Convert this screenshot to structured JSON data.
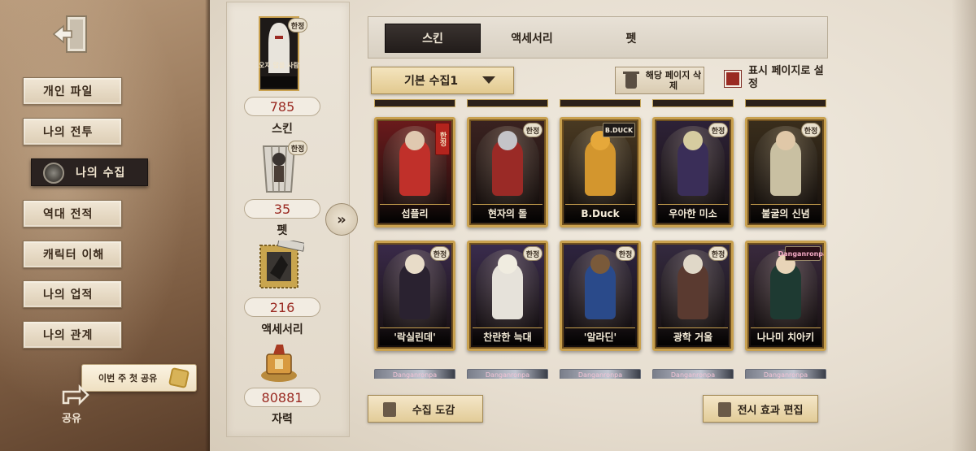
{
  "sidebar": {
    "items": [
      {
        "label": "개인 파일"
      },
      {
        "label": "나의 전투"
      },
      {
        "label": "나의 수집"
      },
      {
        "label": "역대 전적"
      },
      {
        "label": "캐릭터 이해"
      },
      {
        "label": "나의 업적"
      },
      {
        "label": "나의 관계"
      }
    ],
    "active_index": 2,
    "share_bubble": "이번 주 첫 공유",
    "share_label": "공유"
  },
  "stats": {
    "portrait_caption": "오지 않을 사람",
    "portrait_badge": "한정",
    "skin_count": "785",
    "skin_label": "스킨",
    "pet_badge": "한정",
    "pet_count": "35",
    "pet_label": "펫",
    "accessory_count": "216",
    "accessory_label": "액세서리",
    "material_count": "80881",
    "material_label": "자력"
  },
  "tabs": [
    {
      "label": "스킨"
    },
    {
      "label": "액세서리"
    },
    {
      "label": "펫"
    }
  ],
  "toolbar": {
    "collection_select": "기본 수집1",
    "delete_page": "해당 페이지 삭제",
    "set_display": "표시 페이지로 설정"
  },
  "cards_row1": [
    {
      "name": "섭플리",
      "badge": "한정",
      "badge_style": "red",
      "color": "#6b1a1c",
      "fig": "#c0302a",
      "head": "#e0c9b0"
    },
    {
      "name": "현자의 돌",
      "badge": "한정",
      "badge_style": "",
      "color": "#3a2220",
      "fig": "#9a2a26",
      "head": "#c4c4c8"
    },
    {
      "name": "B.Duck",
      "badge": "B.DUCK",
      "badge_style": "bduck",
      "color": "#4a3a22",
      "fig": "#d3962e",
      "head": "#e6a83a"
    },
    {
      "name": "우아한 미소",
      "badge": "한정",
      "badge_style": "",
      "color": "#2e2238",
      "fig": "#3a2e58",
      "head": "#d6cca0"
    },
    {
      "name": "불굴의 신념",
      "badge": "한정",
      "badge_style": "",
      "color": "#3a2e1c",
      "fig": "#c9c0a2",
      "head": "#e0c8a8"
    }
  ],
  "cards_row2": [
    {
      "name": "'락실린데'",
      "badge": "한정",
      "badge_style": "",
      "color": "#3a2a4a",
      "fig": "#2a2230",
      "head": "#e8dcc8"
    },
    {
      "name": "찬란한 늑대",
      "badge": "한정",
      "badge_style": "",
      "color": "#3a2c4e",
      "fig": "#e6e2da",
      "head": "#f0ece0"
    },
    {
      "name": "'알라딘'",
      "badge": "한정",
      "badge_style": "",
      "color": "#2e2440",
      "fig": "#2a4a8a",
      "head": "#7a5a3a"
    },
    {
      "name": "광학 거울",
      "badge": "한정",
      "badge_style": "",
      "color": "#342a40",
      "fig": "#5a3a30",
      "head": "#e0d8c8"
    },
    {
      "name": "나나미 치아키",
      "badge": "Danganronpa",
      "badge_style": "dangan",
      "color": "#3a2a3e",
      "fig": "#1e3a32",
      "head": "#e8d4b8"
    }
  ],
  "dangan_strip_label": "Danganronpa",
  "bottom": {
    "guide_label": "수집 도감",
    "edit_label": "전시 효과 편집"
  }
}
